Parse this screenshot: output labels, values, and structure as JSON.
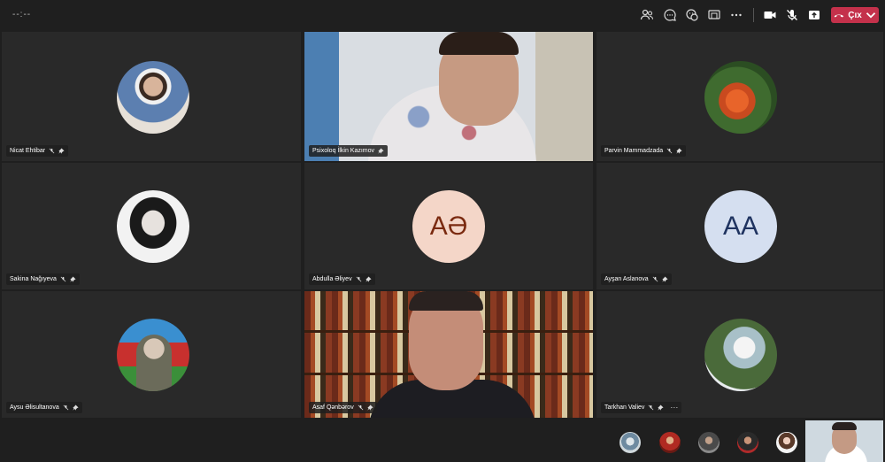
{
  "toolbar": {
    "timer": "--:--",
    "leave_label": "Çıx",
    "icons": [
      "people-icon",
      "chat-icon",
      "reactions-icon",
      "share-tray-icon",
      "more-icon",
      "camera-icon",
      "mic-off-icon",
      "share-icon",
      "phone-icon"
    ],
    "leave_color": "#c4314b"
  },
  "participants": [
    {
      "name": "Nicat Ehtibar",
      "kind": "photo"
    },
    {
      "name": "Psixoloq İlkin Kazımov",
      "kind": "video"
    },
    {
      "name": "Parvin Mammadzada",
      "kind": "photo"
    },
    {
      "name": "Sakina Nağıyeva",
      "kind": "photo"
    },
    {
      "name": "Abdulla Əliyev",
      "kind": "initials",
      "initials": "AƏ",
      "bg": "#f4d6c8",
      "fg": "#7a2a10"
    },
    {
      "name": "Ayşan Aslanova",
      "kind": "initials",
      "initials": "AA",
      "bg": "#d5dff0",
      "fg": "#1f3360"
    },
    {
      "name": "Aysu Əlisultanova",
      "kind": "photo"
    },
    {
      "name": "Asaf Qənbərov",
      "kind": "video"
    },
    {
      "name": "Tarkhan Valiev",
      "kind": "photo"
    }
  ],
  "overflow_count": 5
}
